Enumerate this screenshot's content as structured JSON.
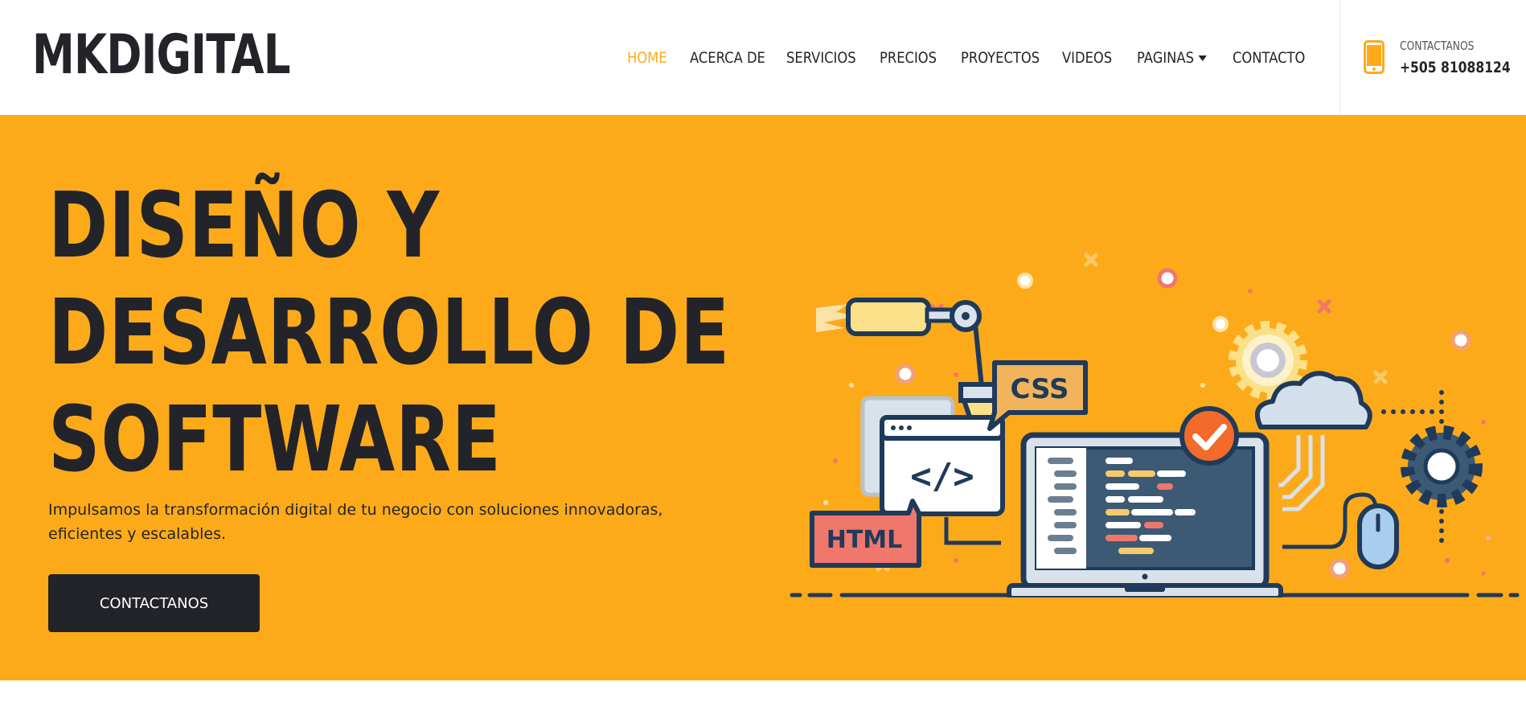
{
  "brand": {
    "logo_text": "MKDIGITAL"
  },
  "nav": {
    "items": [
      {
        "label": "HOME",
        "active": true
      },
      {
        "label": "ACERCA DE"
      },
      {
        "label": "SERVICIOS"
      },
      {
        "label": "PRECIOS"
      },
      {
        "label": "PROYECTOS"
      },
      {
        "label": "VIDEOS"
      },
      {
        "label": "PAGINAS",
        "dropdown": true
      },
      {
        "label": "CONTACTO"
      }
    ]
  },
  "header_contact": {
    "label": "CONTACTANOS",
    "phone": "+505 81088124",
    "icon": "mobile-phone-icon"
  },
  "hero": {
    "title_lines": [
      "DISEÑO Y",
      "DESARROLLO DE",
      "SOFTWARE"
    ],
    "subtitle": "Impulsamos la transformación digital de tu negocio con soluciones innovadoras, eficientes y escalables.",
    "button_label": "CONTACTANOS",
    "illustration": {
      "tag_css": "CSS",
      "tag_html": "HTML",
      "tag_code": "</>"
    }
  },
  "colors": {
    "accent": "#fdaa1a",
    "dark": "#23242a",
    "illustration_navy": "#1f3a5a",
    "illustration_red": "#f0776b",
    "illustration_orange": "#f26b2a"
  }
}
